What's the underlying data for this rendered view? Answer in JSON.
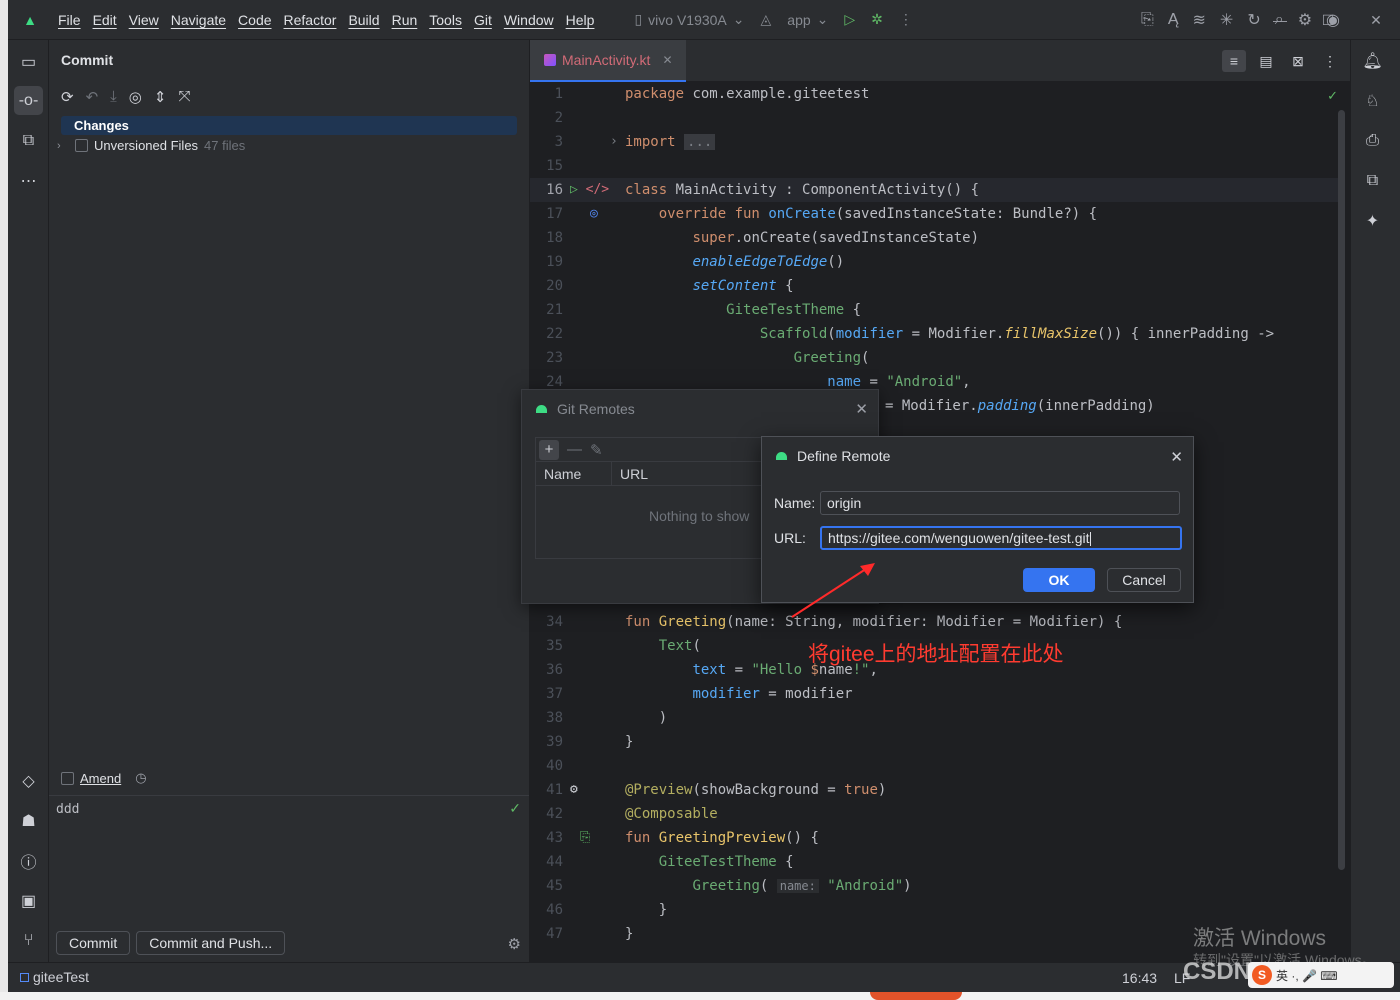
{
  "menu": [
    "File",
    "Edit",
    "View",
    "Navigate",
    "Code",
    "Refactor",
    "Build",
    "Run",
    "Tools",
    "Git",
    "Window",
    "Help"
  ],
  "toolbar": {
    "device": "vivo V1930A",
    "run_config": "app"
  },
  "commit_panel": {
    "title": "Commit",
    "changes_label": "Changes",
    "unversioned_label": "Unversioned Files",
    "unversioned_count": "47 files",
    "amend_label": "Amend",
    "message": "ddd",
    "commit_button": "Commit",
    "commit_push_button": "Commit and Push..."
  },
  "editor": {
    "tab_name": "MainActivity.kt",
    "lines": [
      {
        "n": "1",
        "code": "package com.example.giteetest"
      },
      {
        "n": "2",
        "code": ""
      },
      {
        "n": "3",
        "code": "import ..."
      },
      {
        "n": "15",
        "code": ""
      },
      {
        "n": "16",
        "code": "class MainActivity : ComponentActivity() {"
      },
      {
        "n": "17",
        "code": "    override fun onCreate(savedInstanceState: Bundle?) {"
      },
      {
        "n": "18",
        "code": "        super.onCreate(savedInstanceState)"
      },
      {
        "n": "19",
        "code": "        enableEdgeToEdge()"
      },
      {
        "n": "20",
        "code": "        setContent {"
      },
      {
        "n": "21",
        "code": "            GiteeTestTheme {"
      },
      {
        "n": "22",
        "code": "                Scaffold(modifier = Modifier.fillMaxSize()) { innerPadding ->"
      },
      {
        "n": "23",
        "code": "                    Greeting("
      },
      {
        "n": "24",
        "code": "                        name = \"Android\","
      },
      {
        "n": "25",
        "code": "= Modifier.padding(innerPadding)"
      },
      {
        "n": "34",
        "code": "fun Greeting(name: String, modifier: Modifier = Modifier) {"
      },
      {
        "n": "35",
        "code": "    Text("
      },
      {
        "n": "36",
        "code": "        text = \"Hello $name!\","
      },
      {
        "n": "37",
        "code": "        modifier = modifier"
      },
      {
        "n": "38",
        "code": "    )"
      },
      {
        "n": "39",
        "code": "}"
      },
      {
        "n": "40",
        "code": ""
      },
      {
        "n": "41",
        "code": "@Preview(showBackground = true)"
      },
      {
        "n": "42",
        "code": "@Composable"
      },
      {
        "n": "43",
        "code": "fun GreetingPreview() {"
      },
      {
        "n": "44",
        "code": "    GiteeTestTheme {"
      },
      {
        "n": "45",
        "code": "        Greeting( name: \"Android\")"
      },
      {
        "n": "46",
        "code": "    }"
      },
      {
        "n": "47",
        "code": "}"
      }
    ]
  },
  "git_remotes_dialog": {
    "title": "Git Remotes",
    "col_name": "Name",
    "col_url": "URL",
    "empty_text": "Nothing to show"
  },
  "define_remote_dialog": {
    "title": "Define Remote",
    "name_label": "Name:",
    "name_value": "origin",
    "url_label": "URL:",
    "url_value": "https://gitee.com/wenguowen/gitee-test.git",
    "ok": "OK",
    "cancel": "Cancel"
  },
  "annotation": "将gitee上的地址配置在此处",
  "status": {
    "project": "giteeTest",
    "time": "16:43",
    "line_sep": "LF"
  },
  "watermark": {
    "line1": "激活 Windows",
    "line2": "转到\"设置\"以激活 Windows。",
    "csdn": "CSDN",
    "badge": "英 ·, 🎤 ⌨"
  }
}
